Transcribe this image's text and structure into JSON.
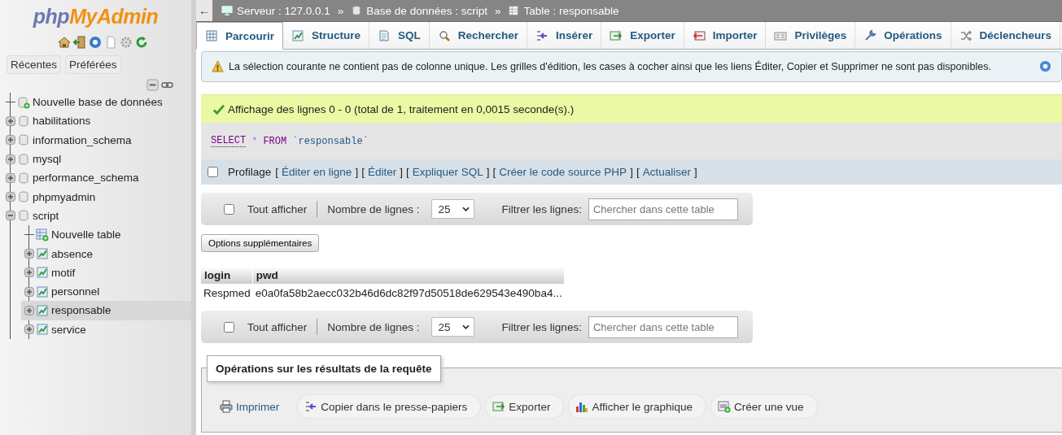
{
  "logo": {
    "php": "php",
    "myadmin": "MyAdmin"
  },
  "sidebar_tabs": [
    "Récentes",
    "Préférées"
  ],
  "tree": [
    {
      "kind": "new",
      "label": "Nouvelle base de données",
      "selected": false
    },
    {
      "kind": "db",
      "label": "habilitations",
      "expanded": false,
      "selected": false
    },
    {
      "kind": "db",
      "label": "information_schema",
      "expanded": false,
      "selected": false
    },
    {
      "kind": "db",
      "label": "mysql",
      "expanded": false,
      "selected": false
    },
    {
      "kind": "db",
      "label": "performance_schema",
      "expanded": false,
      "selected": false
    },
    {
      "kind": "db",
      "label": "phpmyadmin",
      "expanded": false,
      "selected": false
    },
    {
      "kind": "db",
      "label": "script",
      "expanded": true,
      "selected": false,
      "children": [
        {
          "kind": "newtable",
          "label": "Nouvelle table",
          "selected": false
        },
        {
          "kind": "table",
          "label": "absence",
          "expanded": false,
          "selected": false
        },
        {
          "kind": "table",
          "label": "motif",
          "expanded": false,
          "selected": false
        },
        {
          "kind": "table",
          "label": "personnel",
          "expanded": false,
          "selected": false
        },
        {
          "kind": "table",
          "label": "responsable",
          "expanded": false,
          "selected": true
        },
        {
          "kind": "table",
          "label": "service",
          "expanded": false,
          "selected": false
        }
      ]
    }
  ],
  "breadcrumb": {
    "back": "←",
    "items": [
      {
        "kind": "server",
        "label": "Serveur : 127.0.0.1"
      },
      {
        "kind": "db",
        "label": "Base de données : script"
      },
      {
        "kind": "table",
        "label": "Table : responsable"
      }
    ],
    "separator": "»"
  },
  "tabs": [
    {
      "kind": "browse",
      "label": "Parcourir",
      "selected": true
    },
    {
      "kind": "structure",
      "label": "Structure",
      "selected": false
    },
    {
      "kind": "sql",
      "label": "SQL",
      "selected": false
    },
    {
      "kind": "search",
      "label": "Rechercher",
      "selected": false
    },
    {
      "kind": "insert",
      "label": "Insérer",
      "selected": false
    },
    {
      "kind": "export",
      "label": "Exporter",
      "selected": false
    },
    {
      "kind": "import",
      "label": "Importer",
      "selected": false
    },
    {
      "kind": "privileges",
      "label": "Privilèges",
      "selected": false
    },
    {
      "kind": "operations",
      "label": "Opérations",
      "selected": false
    },
    {
      "kind": "triggers",
      "label": "Déclencheurs",
      "selected": false
    }
  ],
  "notice": "La sélection courante ne contient pas de colonne unique. Les grilles d'édition, les cases à cocher ainsi que les liens Éditer, Copier et Supprimer ne sont pas disponibles.",
  "success": "Affichage des lignes 0 - 0 (total de 1, traitement en 0,0015 seconde(s).)",
  "sql": [
    {
      "kind": "keyword",
      "text": "SELECT"
    },
    {
      "kind": "operator",
      "text": "*"
    },
    {
      "kind": "keyword",
      "text": "FROM"
    },
    {
      "kind": "identifier",
      "text": "`responsable`"
    }
  ],
  "profiling": {
    "label": "Profilage",
    "checked": false,
    "links": [
      {
        "before": "[",
        "label": "Éditer en ligne",
        "after": "]"
      },
      {
        "before": "[",
        "label": "Éditer",
        "after": "]"
      },
      {
        "before": "[",
        "label": "Expliquer SQL",
        "after": "]"
      },
      {
        "before": "[",
        "label": "Créer le code source PHP",
        "after": "]"
      },
      {
        "before": "[",
        "label": "Actualiser",
        "after": "]"
      }
    ]
  },
  "navbars": [
    {
      "show_all": "Tout afficher",
      "checked": false,
      "rows_label": "Nombre de lignes :",
      "rows_value": "25",
      "filter_label": "Filtrer les lignes:",
      "filter_placeholder": "Chercher dans cette table"
    },
    {
      "show_all": "Tout afficher",
      "checked": false,
      "rows_label": "Nombre de lignes :",
      "rows_value": "25",
      "filter_label": "Filtrer les lignes:",
      "filter_placeholder": "Chercher dans cette table"
    }
  ],
  "extra_options": "Options supplémentaires",
  "table": {
    "columns": [
      "login",
      "pwd"
    ],
    "rows": [
      [
        "Respmed",
        "e0a0fa58b2aecc032b46d6dc82f97d50518de629543e490ba4..."
      ]
    ]
  },
  "operations": {
    "legend": "Opérations sur les résultats de la requête",
    "buttons": [
      {
        "kind": "print",
        "label": "Imprimer"
      },
      {
        "kind": "copy",
        "label": "Copier dans le presse-papiers"
      },
      {
        "kind": "export",
        "label": "Exporter"
      },
      {
        "kind": "chart",
        "label": "Afficher le graphique"
      },
      {
        "kind": "view",
        "label": "Créer une vue"
      }
    ]
  }
}
